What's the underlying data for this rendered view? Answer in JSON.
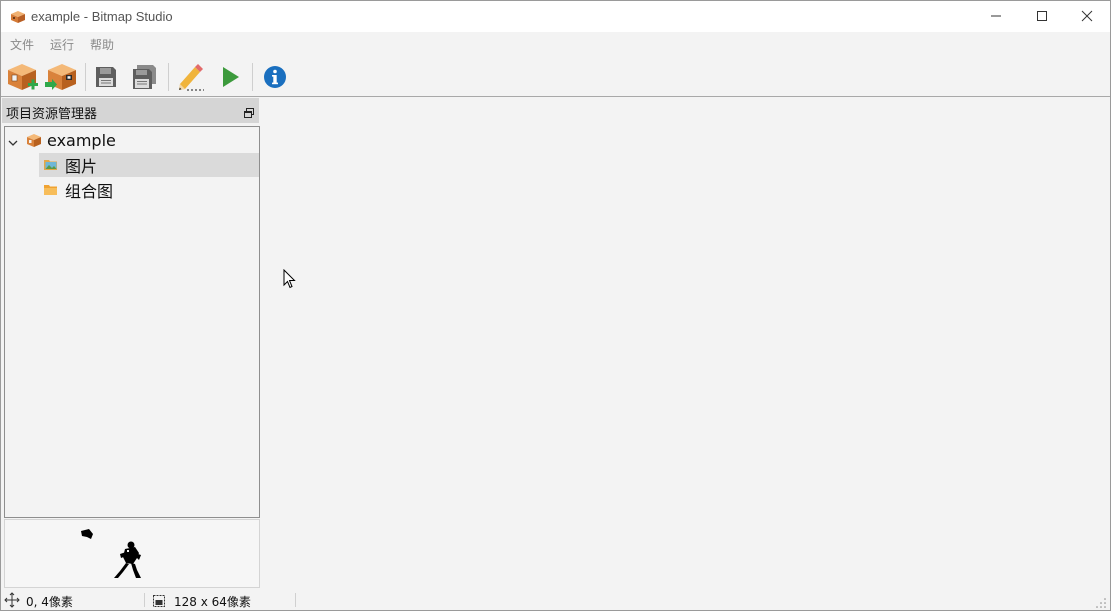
{
  "window": {
    "title": "example - Bitmap Studio"
  },
  "menu": {
    "items": [
      {
        "label": "文件"
      },
      {
        "label": "运行"
      },
      {
        "label": "帮助"
      }
    ]
  },
  "toolbar": {
    "buttons": [
      {
        "name": "new-project",
        "icon": "package-plus-icon"
      },
      {
        "name": "open-project",
        "icon": "package-arrow-icon"
      },
      {
        "name": "save",
        "icon": "floppy-icon"
      },
      {
        "name": "save-all",
        "icon": "floppy-stack-icon"
      },
      {
        "name": "edit",
        "icon": "pencil-icon"
      },
      {
        "name": "run",
        "icon": "play-icon"
      },
      {
        "name": "about",
        "icon": "info-icon"
      }
    ]
  },
  "explorer": {
    "title": "项目资源管理器",
    "root": {
      "label": "example",
      "expanded": true
    },
    "children": [
      {
        "label": "图片",
        "selected": true
      },
      {
        "label": "组合图",
        "selected": false
      }
    ]
  },
  "status": {
    "cursor_position": "0, 4像素",
    "image_size": "128 x 64像素"
  },
  "colors": {
    "selection": "#dadada",
    "panel_header": "#d5d5d5",
    "run_green": "#3c9a3c",
    "info_blue": "#1a6fbf",
    "package_orange": "#d9823b"
  }
}
